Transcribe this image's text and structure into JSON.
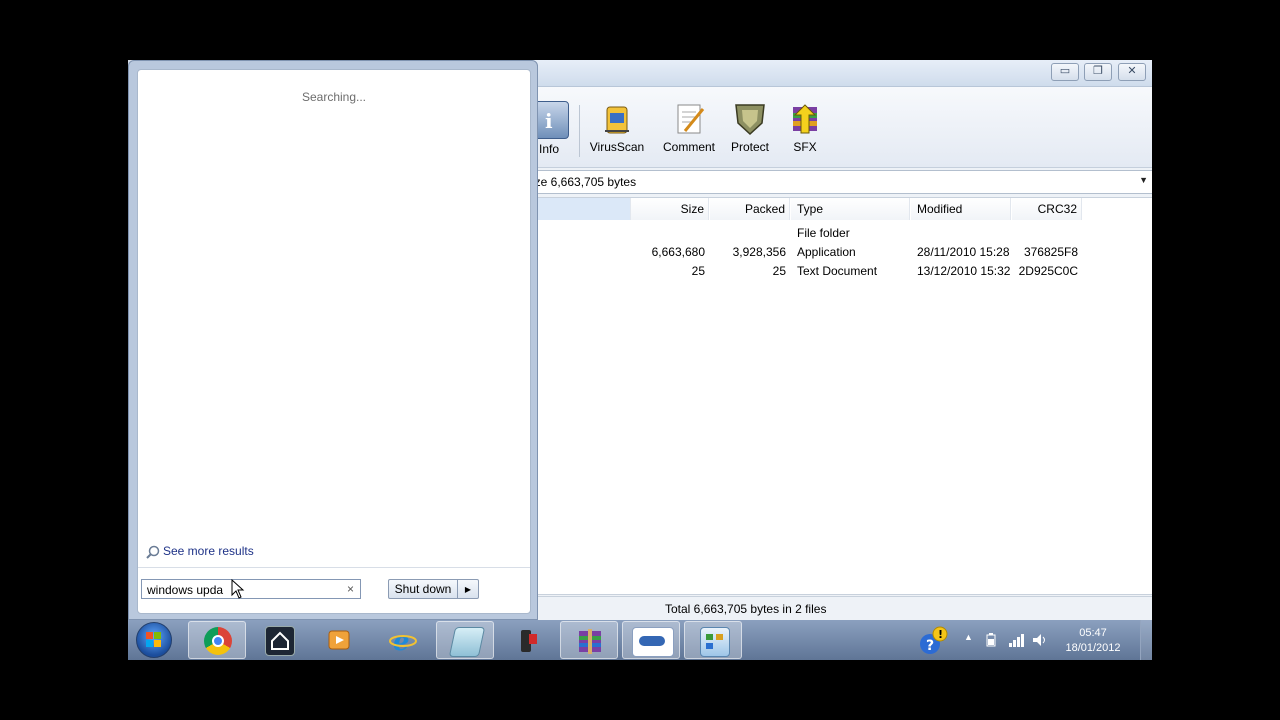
{
  "window": {
    "buttons": {
      "minimize": "▭",
      "restore": "❐",
      "close": "✕"
    },
    "toolbar": [
      {
        "label": "Info",
        "icon": "info-icon"
      },
      {
        "label": "VirusScan",
        "icon": "virusscan-icon"
      },
      {
        "label": "Comment",
        "icon": "comment-icon"
      },
      {
        "label": "Protect",
        "icon": "protect-icon"
      },
      {
        "label": "SFX",
        "icon": "sfx-icon"
      }
    ],
    "address": "ize 6,663,705 bytes",
    "columns": {
      "size": "Size",
      "packed": "Packed",
      "type": "Type",
      "modified": "Modified",
      "crc": "CRC32"
    },
    "rows": [
      {
        "size": "",
        "packed": "",
        "type": "File folder",
        "modified": "",
        "crc": ""
      },
      {
        "size": "6,663,680",
        "packed": "3,928,356",
        "type": "Application",
        "modified": "28/11/2010 15:28",
        "crc": "376825F8"
      },
      {
        "size": "25",
        "packed": "25",
        "type": "Text Document",
        "modified": "13/12/2010 15:32",
        "crc": "2D925C0C"
      }
    ],
    "status": "Total 6,663,705 bytes in 2 files"
  },
  "startmenu": {
    "searching": "Searching...",
    "see_more": "See more results",
    "search_value": "windows upda",
    "clear": "×",
    "shutdown": "Shut down",
    "shutdown_arrow": "▶"
  },
  "taskbar": {
    "apps": [
      "chrome-icon",
      "home-server-icon",
      "media-player-icon",
      "internet-explorer-icon",
      "notepad-icon",
      "camcorder-icon",
      "winrar-icon",
      "window-thumbnail-icon",
      "control-panel-icon"
    ],
    "clock_time": "05:47",
    "clock_date": "18/01/2012"
  }
}
